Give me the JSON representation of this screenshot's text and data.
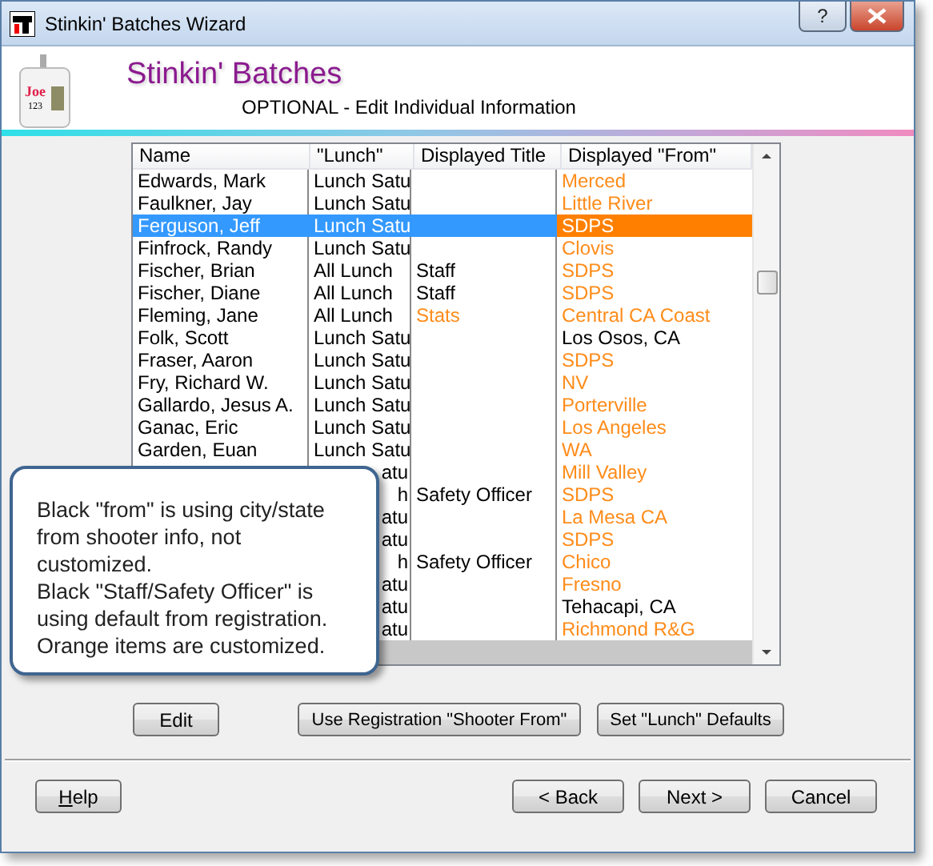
{
  "window": {
    "title": "Stinkin' Batches Wizard",
    "help_button": "?"
  },
  "header": {
    "badge_name": "Joe",
    "badge_number": "123",
    "title": "Stinkin' Batches",
    "subtitle": "OPTIONAL - Edit Individual Information"
  },
  "table": {
    "columns": [
      "Name",
      "\"Lunch\"",
      "Displayed Title",
      "Displayed \"From\""
    ],
    "rows": [
      {
        "name": "Edwards, Mark",
        "lunch": "Lunch Satu",
        "from": "Merced",
        "from_custom": true,
        "selected": false
      },
      {
        "name": "Faulkner, Jay",
        "lunch": "Lunch Satu",
        "from": "Little River",
        "from_custom": true,
        "selected": false
      },
      {
        "name": "Ferguson, Jeff",
        "lunch": "Lunch Satu",
        "from": "SDPS",
        "from_custom": true,
        "selected": true
      },
      {
        "name": "Finfrock, Randy",
        "lunch": "Lunch Satu",
        "from": "Clovis",
        "from_custom": true,
        "selected": false
      },
      {
        "name": "Fischer, Brian",
        "lunch": "All Lunch",
        "title": "Staff",
        "title_custom": false,
        "from": "SDPS",
        "from_custom": true,
        "selected": false
      },
      {
        "name": "Fischer, Diane",
        "lunch": "All Lunch",
        "title": "Staff",
        "title_custom": false,
        "from": "SDPS",
        "from_custom": true,
        "selected": false
      },
      {
        "name": "Fleming, Jane",
        "lunch": "All Lunch",
        "title": "Stats",
        "title_custom": true,
        "from": "Central CA Coast",
        "from_custom": true,
        "selected": false
      },
      {
        "name": "Folk, Scott",
        "lunch": "Lunch Satu",
        "from": "Los Osos, CA",
        "from_custom": false,
        "selected": false
      },
      {
        "name": "Fraser, Aaron",
        "lunch": "Lunch Satu",
        "from": "SDPS",
        "from_custom": true,
        "selected": false
      },
      {
        "name": "Fry, Richard W.",
        "lunch": "Lunch Satu",
        "from": "NV",
        "from_custom": true,
        "selected": false
      },
      {
        "name": "Gallardo, Jesus A.",
        "lunch": "Lunch Satu",
        "from": "Porterville",
        "from_custom": true,
        "selected": false
      },
      {
        "name": "Ganac, Eric",
        "lunch": "Lunch Satu",
        "from": "Los Angeles",
        "from_custom": true,
        "selected": false
      },
      {
        "name": "Garden, Euan",
        "lunch": "Lunch Satu",
        "from": "WA",
        "from_custom": true,
        "selected": false
      },
      {
        "lunch": "atu",
        "from": "Mill Valley",
        "from_custom": true,
        "selected": false
      },
      {
        "lunch": "h",
        "title": "Safety Officer",
        "title_custom": false,
        "from": "SDPS",
        "from_custom": true,
        "selected": false
      },
      {
        "lunch": "atu",
        "from": "La Mesa CA",
        "from_custom": true,
        "selected": false
      },
      {
        "lunch": "atu",
        "from": "SDPS",
        "from_custom": true,
        "selected": false
      },
      {
        "lunch": "h",
        "title": "Safety Officer",
        "title_custom": false,
        "from": "Chico",
        "from_custom": true,
        "selected": false
      },
      {
        "lunch": "atu",
        "from": "Fresno",
        "from_custom": true,
        "selected": false
      },
      {
        "lunch": "atu",
        "from": "Tehacapi, CA",
        "from_custom": false,
        "selected": false
      },
      {
        "lunch": "atu",
        "from": "Richmond R&G",
        "from_custom": true,
        "selected": false
      }
    ]
  },
  "callout": {
    "text": "Black \"from\" is using city/state from shooter info, not customized.\nBlack \"Staff/Safety Officer\" is using default from registration.\nOrange items are customized."
  },
  "actions": [
    "Edit",
    "Use Registration \"Shooter From\"",
    "Set \"Lunch\" Defaults"
  ],
  "nav": {
    "help": "Help",
    "buttons": [
      "< Back",
      "Next >",
      "Cancel"
    ]
  }
}
